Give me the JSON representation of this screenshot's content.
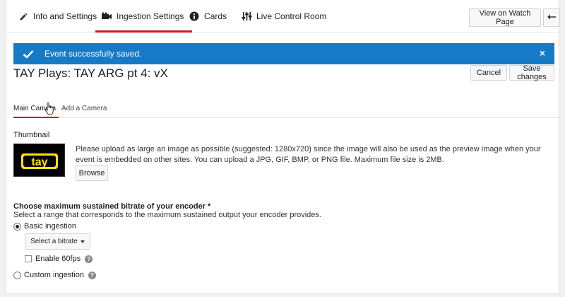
{
  "nav": {
    "tabs": [
      {
        "label": "Info and Settings",
        "icon": "pencil-icon"
      },
      {
        "label": "Ingestion Settings",
        "icon": "video-camera-icon"
      },
      {
        "label": "Cards",
        "icon": "info-icon"
      },
      {
        "label": "Live Control Room",
        "icon": "sliders-icon"
      }
    ],
    "active_tab": "Ingestion Settings",
    "watch_button": "View on Watch Page",
    "back_icon": "back-arrow-icon"
  },
  "banner": {
    "message": "Event successfully saved.",
    "close_glyph": "×",
    "color": "#167ac6"
  },
  "event": {
    "title": "TAY Plays: TAY ARG pt 4: vX",
    "cancel_label": "Cancel",
    "save_label": "Save changes"
  },
  "subtabs": {
    "main": "Main Camera",
    "add": "Add a Camera"
  },
  "thumbnail": {
    "label": "Thumbnail",
    "logo_text": "tay",
    "description": "Please upload as large an image as possible (suggested: 1280x720) since the image will also be used as the preview image when your event is embedded on other sites. You can upload a JPG, GIF, BMP, or PNG file. Maximum file size is 2MB.",
    "browse_label": "Browse"
  },
  "bitrate": {
    "title": "Choose maximum sustained bitrate of your encoder *",
    "description": "Select a range that corresponds to the maximum sustained output your encoder provides.",
    "basic_label": "Basic ingestion",
    "select_label": "Select a bitrate",
    "fps_label": "Enable 60fps",
    "custom_label": "Custom ingestion",
    "help_glyph": "?"
  },
  "colors": {
    "accent_red": "#cc181e",
    "banner_blue": "#167ac6"
  }
}
